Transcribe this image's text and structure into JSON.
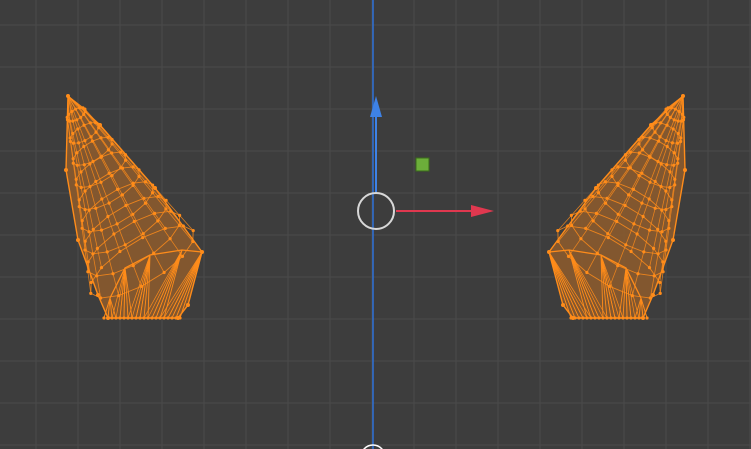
{
  "viewport": {
    "view": "front-orthographic",
    "shading": "wireframe",
    "colors": {
      "background": "#3d3d3d",
      "grid": "#4a4a4a",
      "z_axis": "#2f6fd0",
      "gizmo_x": "#e0384f",
      "gizmo_z": "#3e82e6",
      "pivot_ring": "#d8d8d8",
      "selection": "#ff8c1a",
      "selection_fill": "#8a5a2e",
      "light": "#6cae3a"
    },
    "objects": [
      {
        "name": "horn-left",
        "selected": true
      },
      {
        "name": "horn-right",
        "selected": true
      }
    ],
    "gizmo": {
      "type": "move",
      "axes": [
        "x",
        "z"
      ],
      "icon": "transform-gizmo-icon"
    },
    "light": {
      "type": "light",
      "icon": "light-handle-icon"
    }
  }
}
